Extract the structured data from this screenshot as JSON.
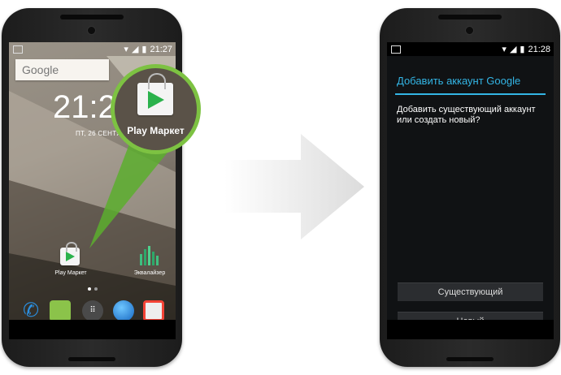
{
  "left_phone": {
    "status_time": "21:27",
    "search_label": "Google",
    "clock_text": "21:2",
    "date_text": "ПТ, 26 СЕНТЯБРЯ",
    "home_apps": [
      {
        "label": "Play Маркет",
        "icon": "play-market-icon"
      },
      {
        "label": "Эквалайзер",
        "icon": "equalizer-icon"
      }
    ],
    "dock": [
      "phone-icon",
      "hangouts-icon",
      "app-drawer-icon",
      "browser-icon",
      "camera-icon"
    ],
    "magnifier_label": "Play Маркет"
  },
  "right_phone": {
    "status_time": "21:28",
    "dialog": {
      "title": "Добавить аккаунт Google",
      "message": "Добавить существующий аккаунт или создать новый?",
      "buttons": [
        {
          "label": "Существующий"
        },
        {
          "label": "Новый"
        }
      ]
    }
  },
  "colors": {
    "accent_blue": "#33b5e5",
    "highlight_green": "#7dc242"
  }
}
